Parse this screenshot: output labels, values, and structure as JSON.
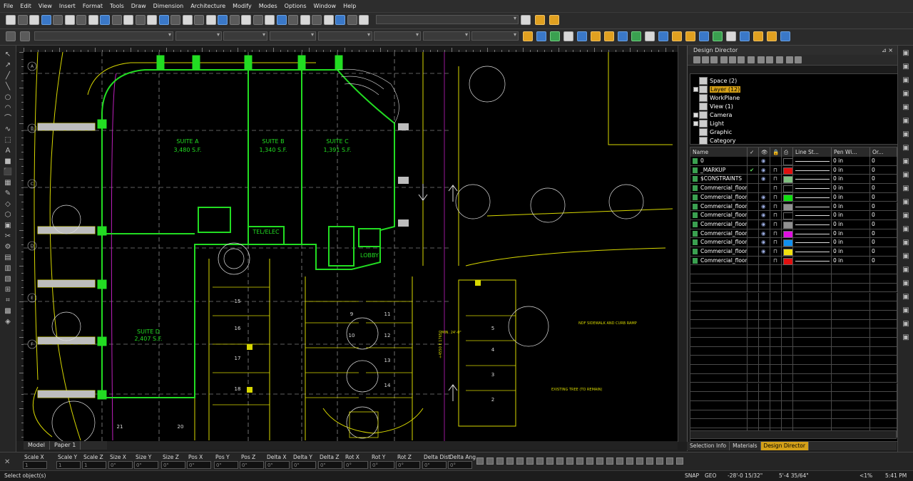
{
  "menu": [
    "File",
    "Edit",
    "View",
    "Insert",
    "Format",
    "Tools",
    "Draw",
    "Dimension",
    "Architecture",
    "Modify",
    "Modes",
    "Options",
    "Window",
    "Help"
  ],
  "drawing": {
    "suites": [
      {
        "name": "SUITE A",
        "area": "3,480 S.F."
      },
      {
        "name": "SUITE B",
        "area": "1,340 S.F."
      },
      {
        "name": "SUITE C",
        "area": "1,391 S.F."
      },
      {
        "name": "SUITE D",
        "area": "2,407 S.F."
      }
    ],
    "room_labels": [
      "TEL/ELEC",
      "LOBBY"
    ],
    "parking_numbers": [
      "15",
      "16",
      "17",
      "18",
      "9",
      "10",
      "11",
      "12",
      "13",
      "14",
      "5",
      "4",
      "3",
      "2"
    ],
    "grid_numbers": [
      "21",
      "20"
    ],
    "grid_letters": [
      "A",
      "B",
      "C",
      "D",
      "E",
      "F"
    ],
    "notes": [
      "NDF SIDEWALK AND CURB RAMP",
      "EXISTING TREE (TO REMAIN)",
      "MIN. 24'-0\"",
      "+4550 E 17650"
    ]
  },
  "canvas_tabs": [
    "Model",
    "Paper 1"
  ],
  "design_director": {
    "title": "Design Director",
    "pin": "⊿ ×",
    "tree": [
      {
        "label": "Space (2)",
        "expand": false,
        "selected": false
      },
      {
        "label": "Layer (12)",
        "expand": true,
        "selected": true
      },
      {
        "label": "WorkPlane",
        "expand": false,
        "selected": false
      },
      {
        "label": "View (1)",
        "expand": false,
        "selected": false
      },
      {
        "label": "Camera",
        "expand": true,
        "selected": false
      },
      {
        "label": "Light",
        "expand": true,
        "selected": false
      },
      {
        "label": "Graphic",
        "expand": false,
        "selected": false
      },
      {
        "label": "Category",
        "expand": false,
        "selected": false
      }
    ],
    "columns": [
      "Name",
      "✓",
      "👁",
      "🔒",
      "⎙",
      "Line St...",
      "Pen Wi...",
      "Or..."
    ],
    "layers": [
      {
        "name": "0",
        "active": false,
        "eye": true,
        "lock": false,
        "color": "#000000",
        "pen": "0 in",
        "order": "0"
      },
      {
        "name": "_MARKUP",
        "active": true,
        "eye": true,
        "lock": true,
        "color": "#e01010",
        "pen": "0 in",
        "order": "0"
      },
      {
        "name": "$CONSTRAINTS",
        "active": false,
        "eye": true,
        "lock": true,
        "color": "#80c080",
        "pen": "0 in",
        "order": "0"
      },
      {
        "name": "Commercial_floor",
        "active": false,
        "eye": false,
        "lock": true,
        "color": "#000000",
        "pen": "0 in",
        "order": "0"
      },
      {
        "name": "Commercial_floor",
        "active": false,
        "eye": true,
        "lock": true,
        "color": "#10e010",
        "pen": "0 in",
        "order": "0"
      },
      {
        "name": "Commercial_floor",
        "active": false,
        "eye": true,
        "lock": true,
        "color": "#909090",
        "pen": "0 in",
        "order": "0"
      },
      {
        "name": "Commercial_floor",
        "active": false,
        "eye": true,
        "lock": true,
        "color": "#000000",
        "pen": "0 in",
        "order": "0"
      },
      {
        "name": "Commercial_floor",
        "active": false,
        "eye": true,
        "lock": true,
        "color": "#909090",
        "pen": "0 in",
        "order": "0"
      },
      {
        "name": "Commercial_floor",
        "active": false,
        "eye": true,
        "lock": true,
        "color": "#e010e0",
        "pen": "0 in",
        "order": "0"
      },
      {
        "name": "Commercial_floor",
        "active": false,
        "eye": true,
        "lock": true,
        "color": "#1090f0",
        "pen": "0 in",
        "order": "0"
      },
      {
        "name": "Commercial_floor",
        "active": false,
        "eye": true,
        "lock": true,
        "color": "#f0e010",
        "pen": "0 in",
        "order": "0"
      },
      {
        "name": "Commercial_floor",
        "active": false,
        "eye": false,
        "lock": true,
        "color": "#e01010",
        "pen": "0 in",
        "order": "0"
      }
    ],
    "bottom_tabs": [
      "Selection Info",
      "Materials",
      "Design Director"
    ]
  },
  "coords": {
    "labels": [
      "Scale X",
      "Scale Y",
      "Scale Z",
      "Size X",
      "Size Y",
      "Size Z",
      "Pos X",
      "Pos Y",
      "Pos Z",
      "Delta X",
      "Delta Y",
      "Delta Z",
      "Rot X",
      "Rot Y",
      "Rot Z",
      "Delta Dist",
      "Delta Ang"
    ],
    "placeholders": [
      "1",
      "1",
      "1",
      "0\"",
      "0\"",
      "0\"",
      "0\"",
      "0\"",
      "0\"",
      "0\"",
      "0\"",
      "0\"",
      "0°",
      "0°",
      "0°",
      "0\"",
      "0°"
    ]
  },
  "status": {
    "prompt": "Select object(s)",
    "snap": "SNAP",
    "geo": "GEO",
    "x": "-28'-0 15/32\"",
    "y": "5'-4 35/64\"",
    "zoom": "<1%",
    "time": "5:41 PM"
  }
}
